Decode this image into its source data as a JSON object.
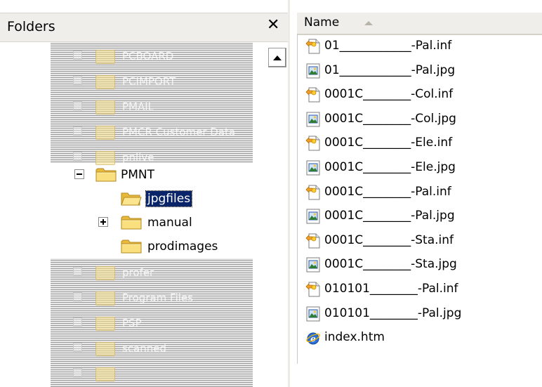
{
  "folders_pane": {
    "title": "Folders",
    "close_glyph": "✕"
  },
  "obscured_top_rows": [
    {
      "label": "PCBOARD"
    },
    {
      "label": "PCIMPORT"
    },
    {
      "label": "PMAIL"
    },
    {
      "label": "PMCR Customer Data"
    },
    {
      "label": "pnlive"
    }
  ],
  "tree": [
    {
      "label": "PMNT",
      "expander": "minus",
      "selected": false,
      "level": 0
    },
    {
      "label": "jpgfiles",
      "expander": "none",
      "selected": true,
      "level": 1
    },
    {
      "label": "manual",
      "expander": "plus",
      "selected": false,
      "level": 1
    },
    {
      "label": "prodimages",
      "expander": "none",
      "selected": false,
      "level": 1
    }
  ],
  "obscured_bottom_rows": [
    {
      "label": "profer"
    },
    {
      "label": "Program Files"
    },
    {
      "label": "PSP"
    },
    {
      "label": "scanned"
    },
    {
      "label": ""
    }
  ],
  "files_pane": {
    "column_header": "Name",
    "sort": "ascending"
  },
  "files": [
    {
      "name": "01____________-Pal.inf",
      "type": "inf"
    },
    {
      "name": "01____________-Pal.jpg",
      "type": "jpg"
    },
    {
      "name": "0001C________-Col.inf",
      "type": "inf"
    },
    {
      "name": "0001C________-Col.jpg",
      "type": "jpg"
    },
    {
      "name": "0001C________-Ele.inf",
      "type": "inf"
    },
    {
      "name": "0001C________-Ele.jpg",
      "type": "jpg"
    },
    {
      "name": "0001C________-Pal.inf",
      "type": "inf"
    },
    {
      "name": "0001C________-Pal.jpg",
      "type": "jpg"
    },
    {
      "name": "0001C________-Sta.inf",
      "type": "inf"
    },
    {
      "name": "0001C________-Sta.jpg",
      "type": "jpg"
    },
    {
      "name": "010101________-Pal.inf",
      "type": "inf"
    },
    {
      "name": "010101________-Pal.jpg",
      "type": "jpg"
    },
    {
      "name": "index.htm",
      "type": "htm"
    }
  ],
  "colors": {
    "selection": "#0a246a",
    "header_bg": "#efeeea",
    "folder_yellow": "#f7d66b"
  }
}
